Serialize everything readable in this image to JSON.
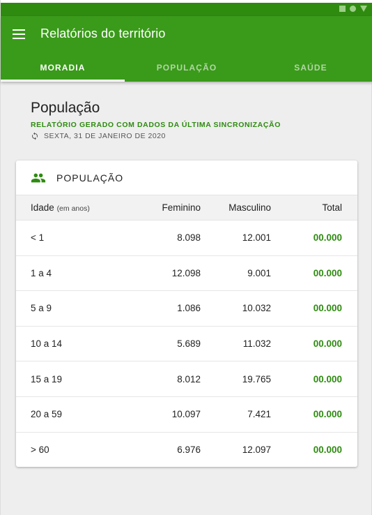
{
  "app": {
    "title": "Relatórios do território",
    "tabs": [
      {
        "label": "MORADIA",
        "active": true
      },
      {
        "label": "POPULAÇÃO",
        "active": false
      },
      {
        "label": "SAÚDE",
        "active": false
      }
    ]
  },
  "page": {
    "title": "População",
    "subtitle": "RELATÓRIO GERADO COM DADOS DA ÚLTIMA SINCRONIZAÇÃO",
    "sync_date": "SEXTA, 31 DE JANEIRO DE 2020"
  },
  "card": {
    "title": "POPULAÇÃO",
    "columns": {
      "age": "Idade",
      "age_unit": "(em anos)",
      "female": "Feminino",
      "male": "Masculino",
      "total": "Total"
    },
    "rows": [
      {
        "age": "< 1",
        "female": "8.098",
        "male": "12.001",
        "total": "00.000"
      },
      {
        "age": "1 a 4",
        "female": "12.098",
        "male": "9.001",
        "total": "00.000"
      },
      {
        "age": "5 a 9",
        "female": "1.086",
        "male": "10.032",
        "total": "00.000"
      },
      {
        "age": "10 a 14",
        "female": "5.689",
        "male": "11.032",
        "total": "00.000"
      },
      {
        "age": "15 a 19",
        "female": "8.012",
        "male": "19.765",
        "total": "00.000"
      },
      {
        "age": "20 a 59",
        "female": "10.097",
        "male": "7.421",
        "total": "00.000"
      },
      {
        "age": "> 60",
        "female": "6.976",
        "male": "12.097",
        "total": "00.000"
      }
    ]
  },
  "colors": {
    "primary": "#3a9a1a",
    "primary_dark": "#2e8b10",
    "accent_text": "#2e8b10"
  },
  "icons": {
    "menu": "menu-icon",
    "sync": "sync-icon",
    "people": "people-icon"
  }
}
